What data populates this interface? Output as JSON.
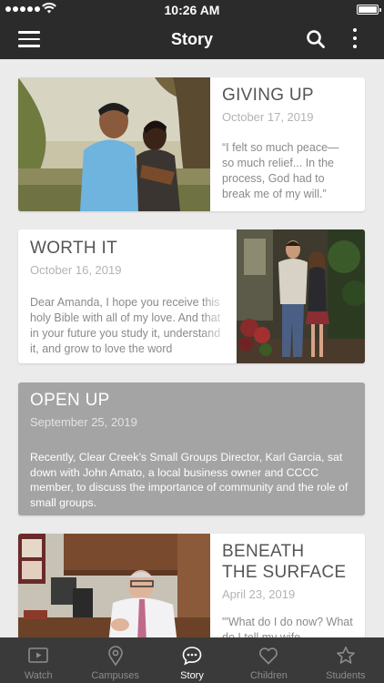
{
  "status_bar": {
    "time": "10:26 AM"
  },
  "navbar": {
    "title": "Story",
    "icons": [
      "hamburger-menu-icon",
      "search-icon",
      "more-vertical-icon"
    ]
  },
  "stories": [
    {
      "title": "GIVING UP",
      "date": "October 17, 2019",
      "excerpt": "“I felt so much peace—\nso much relief... In the\nprocess, God had to\nbreak me of my will.”",
      "image": "couple-embracing-outdoors-photo"
    },
    {
      "title": "WORTH IT",
      "date": "October 16, 2019",
      "excerpt": "Dear Amanda, I hope you receive this holy Bible with all of my love. And that in your future you study it, understand it, and grow to love the word",
      "image": "couple-standing-by-flowers-photo"
    },
    {
      "title": "OPEN UP",
      "date": "September 25, 2019",
      "excerpt": "Recently, Clear Creek’s Small Groups Director, Karl Garcia, sat down with John Amato, a local business owner and CCCC member, to discuss the importance of community and the role of small groups."
    },
    {
      "title_line1": "BENEATH",
      "title_line2": "THE SURFACE",
      "date": "April 23, 2019",
      "excerpt": "\"'What do I do now? What do I tell my wife",
      "image": "man-at-office-desk-photo"
    }
  ],
  "tabs": [
    {
      "label": "Watch",
      "icon": "video-play-icon",
      "active": false
    },
    {
      "label": "Campuses",
      "icon": "location-pin-icon",
      "active": false
    },
    {
      "label": "Story",
      "icon": "chat-bubble-icon",
      "active": true
    },
    {
      "label": "Children",
      "icon": "heart-icon",
      "active": false
    },
    {
      "label": "Students",
      "icon": "star-icon",
      "active": false
    }
  ],
  "colors": {
    "bar": "#2b2b2b",
    "tabbar": "#3a3a3a",
    "background": "#ebebeb",
    "featured_card": "#a4a4a4",
    "tab_inactive": "#8c8c8c",
    "tab_active": "#ffffff"
  }
}
